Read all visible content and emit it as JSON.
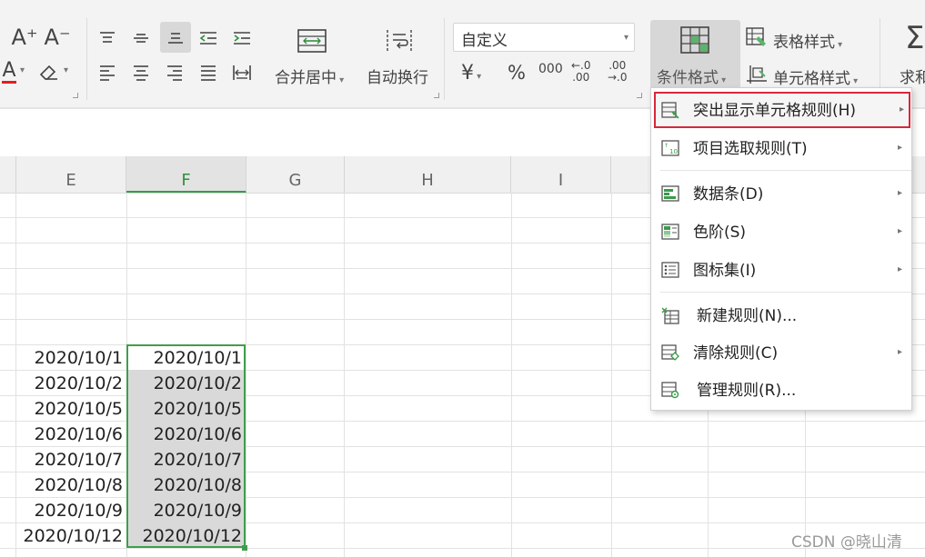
{
  "ribbon": {
    "font_size_increase": "A⁺",
    "font_size_decrease": "A⁻",
    "font_color_icon": "A",
    "merge_center_label": "合并居中",
    "wrap_text_label": "自动换行",
    "number_format_value": "自定义",
    "currency_symbol": "¥",
    "percent_symbol": "%",
    "thousands_symbol": "000",
    "dec_increase_top": "←.0",
    "dec_increase_bottom": ".00",
    "dec_decrease_top": ".00",
    "dec_decrease_bottom": "→.0",
    "conditional_format_label": "条件格式",
    "table_style_label": "表格样式",
    "cell_style_label": "单元格样式",
    "sum_label": "求和",
    "sum_symbol": "Σ"
  },
  "columns": [
    {
      "label": "E",
      "selected": false
    },
    {
      "label": "F",
      "selected": true
    },
    {
      "label": "G",
      "selected": false
    },
    {
      "label": "H",
      "selected": false
    },
    {
      "label": "I",
      "selected": false
    }
  ],
  "rows": [
    {
      "e": "",
      "f": ""
    },
    {
      "e": "",
      "f": ""
    },
    {
      "e": "",
      "f": ""
    },
    {
      "e": "",
      "f": ""
    },
    {
      "e": "",
      "f": ""
    },
    {
      "e": "",
      "f": ""
    },
    {
      "e": "2020/10/1",
      "f": "2020/10/1"
    },
    {
      "e": "2020/10/2",
      "f": "2020/10/2"
    },
    {
      "e": "2020/10/5",
      "f": "2020/10/5"
    },
    {
      "e": "2020/10/6",
      "f": "2020/10/6"
    },
    {
      "e": "2020/10/7",
      "f": "2020/10/7"
    },
    {
      "e": "2020/10/8",
      "f": "2020/10/8"
    },
    {
      "e": "2020/10/9",
      "f": "2020/10/9"
    },
    {
      "e": "2020/10/12",
      "f": "2020/10/12"
    }
  ],
  "menu": {
    "items": [
      {
        "label": "突出显示单元格规则(H)",
        "icon": "highlight-cells-rules-icon",
        "submenu": true,
        "highlighted": true
      },
      {
        "label": "项目选取规则(T)",
        "icon": "top-bottom-rules-icon",
        "submenu": true
      },
      {
        "label": "数据条(D)",
        "icon": "data-bars-icon",
        "submenu": true
      },
      {
        "label": "色阶(S)",
        "icon": "color-scales-icon",
        "submenu": true
      },
      {
        "label": "图标集(I)",
        "icon": "icon-sets-icon",
        "submenu": true
      },
      {
        "label": "新建规则(N)...",
        "icon": "new-rule-icon",
        "submenu": false
      },
      {
        "label": "清除规则(C)",
        "icon": "clear-rules-icon",
        "submenu": true
      },
      {
        "label": "管理规则(R)...",
        "icon": "manage-rules-icon",
        "submenu": false
      }
    ],
    "arrow": "▸"
  },
  "watermark": "CSDN @晓山清",
  "colors": {
    "selection_green": "#3f9e4c",
    "highlight_red": "#d6283a",
    "cell_fill": "#d9d9d9"
  }
}
